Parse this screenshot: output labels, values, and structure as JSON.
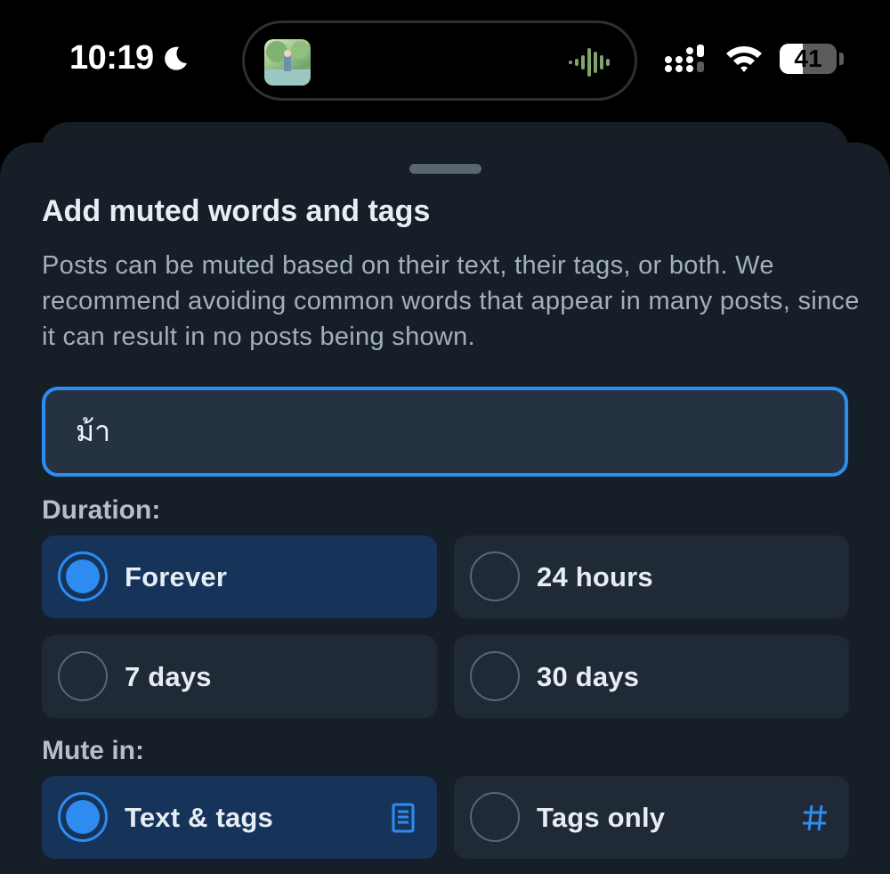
{
  "status_bar": {
    "time": "10:19",
    "battery_level": "41",
    "battery_fraction": 0.41,
    "icons": [
      "moon-icon",
      "album-art-thumbnail",
      "waveform-icon",
      "cellular-signal-icon",
      "wifi-icon",
      "battery-icon"
    ]
  },
  "sheet": {
    "title": "Add muted words and tags",
    "description": "Posts can be muted based on their text, their tags, or both. We recommend avoiding common words that appear in many posts, since it can result in no posts being shown.",
    "input_value": "ม้า",
    "duration": {
      "label": "Duration:",
      "options": [
        {
          "label": "Forever",
          "selected": true
        },
        {
          "label": "24 hours",
          "selected": false
        },
        {
          "label": "7 days",
          "selected": false
        },
        {
          "label": "30 days",
          "selected": false
        }
      ]
    },
    "mute_in": {
      "label": "Mute in:",
      "options": [
        {
          "label": "Text & tags",
          "selected": true,
          "icon": "document-icon"
        },
        {
          "label": "Tags only",
          "selected": false,
          "icon": "hashtag-icon",
          "icon_glyph": "#"
        }
      ]
    }
  },
  "colors": {
    "accent": "#2e8cf0",
    "sheet_background": "#161e27",
    "option_background": "#1f2a36",
    "option_selected_background": "#16335a",
    "waveform": "#7fa46a"
  }
}
